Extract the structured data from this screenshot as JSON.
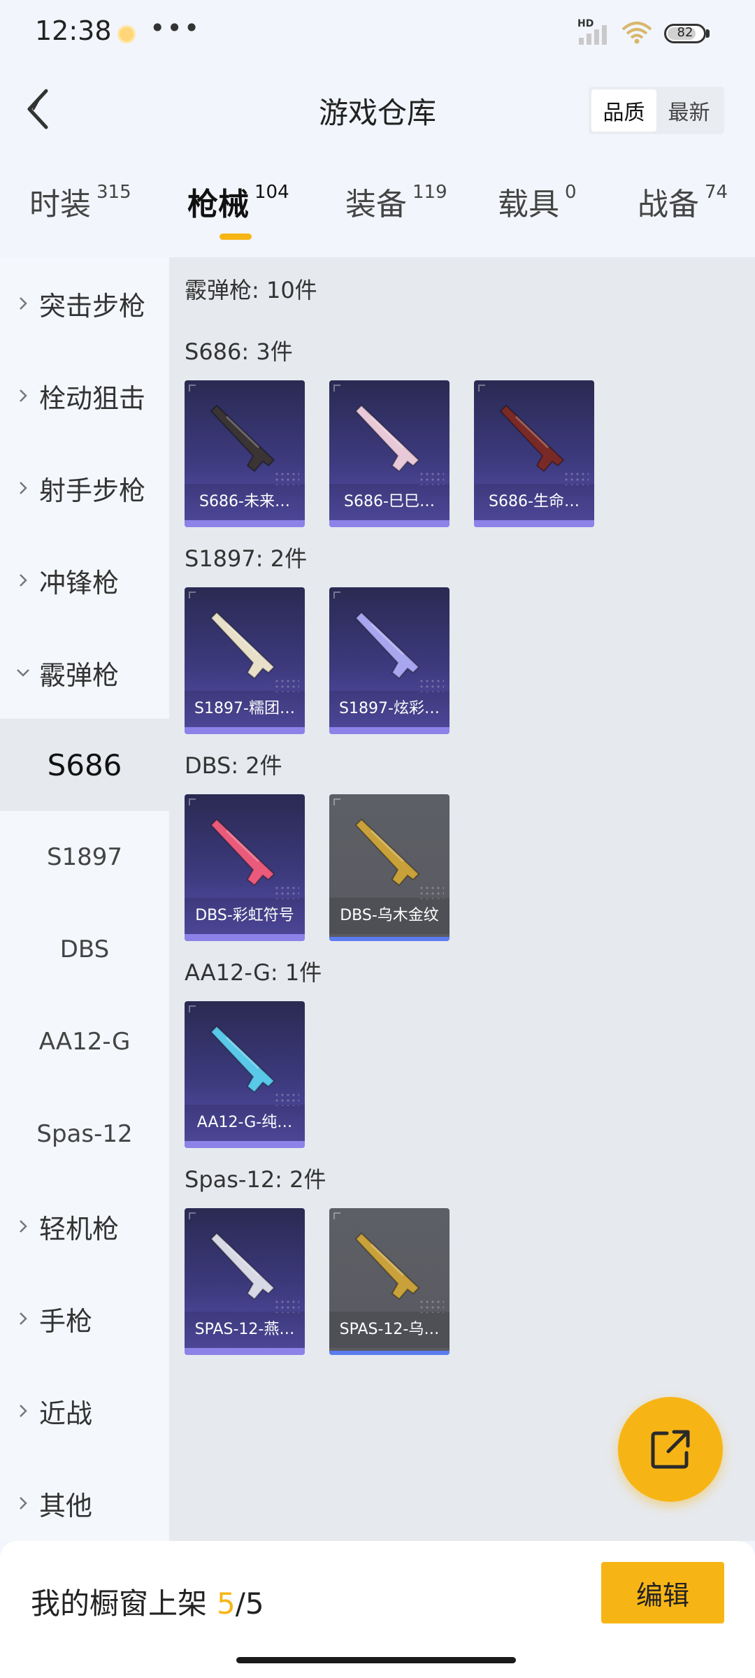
{
  "status_bar": {
    "time": "12:38",
    "dots": "•••",
    "network": "HD",
    "battery": "82",
    "battery_level_percent": 82
  },
  "header": {
    "title": "游戏仓库",
    "sort_options": [
      "品质",
      "最新"
    ],
    "sort_active": "品质"
  },
  "tabs": [
    {
      "label": "时装",
      "count": "315"
    },
    {
      "label": "枪械",
      "count": "104",
      "active": true
    },
    {
      "label": "装备",
      "count": "119"
    },
    {
      "label": "载具",
      "count": "0"
    },
    {
      "label": "战备",
      "count": "74"
    }
  ],
  "sidebar": {
    "categories": [
      {
        "label": "突击步枪",
        "expanded": false
      },
      {
        "label": "栓动狙击",
        "expanded": false
      },
      {
        "label": "射手步枪",
        "expanded": false
      },
      {
        "label": "冲锋枪",
        "expanded": false
      },
      {
        "label": "霰弹枪",
        "expanded": true
      },
      {
        "label": "轻机枪",
        "expanded": false
      },
      {
        "label": "手枪",
        "expanded": false
      },
      {
        "label": "近战",
        "expanded": false
      },
      {
        "label": "其他",
        "expanded": false
      }
    ],
    "subcategories": [
      "S686",
      "S1897",
      "DBS",
      "AA12-G",
      "Spas-12"
    ],
    "active_sub": "S686"
  },
  "content": {
    "total": "霰弹枪: 10件",
    "groups": [
      {
        "title": "S686: 3件",
        "items": [
          {
            "name": "S686-未来…",
            "style": "purple",
            "gun": "#3a3434"
          },
          {
            "name": "S686-巳巳…",
            "style": "purple",
            "gun": "#e8c9d8"
          },
          {
            "name": "S686-生命…",
            "style": "purple",
            "gun": "#7a2a26"
          }
        ]
      },
      {
        "title": "S1897: 2件",
        "items": [
          {
            "name": "S1897-糯团…",
            "style": "purple",
            "gun": "#e8e0c8"
          },
          {
            "name": "S1897-炫彩…",
            "style": "purple",
            "gun": "#a9a6f0"
          }
        ]
      },
      {
        "title": "DBS: 2件",
        "items": [
          {
            "name": "DBS-彩虹符号",
            "style": "purple",
            "gun": "#e95a7b"
          },
          {
            "name": "DBS-乌木金纹",
            "style": "gray",
            "gun": "#c9a13a"
          }
        ]
      },
      {
        "title": "AA12-G: 1件",
        "items": [
          {
            "name": "AA12-G-纯…",
            "style": "purple",
            "gun": "#5ac8e8"
          }
        ]
      },
      {
        "title": "Spas-12: 2件",
        "items": [
          {
            "name": "SPAS-12-燕…",
            "style": "purple",
            "gun": "#d9d9e6"
          },
          {
            "name": "SPAS-12-乌…",
            "style": "gray",
            "gun": "#c9a13a"
          }
        ]
      }
    ]
  },
  "bottom_bar": {
    "label": "我的橱窗上架",
    "count": "5",
    "separator": "/",
    "max": "5",
    "edit_label": "编辑"
  },
  "colors": {
    "accent": "#f7b515",
    "card_purple": "#3d3a7e",
    "card_gray": "#5d5f66"
  }
}
